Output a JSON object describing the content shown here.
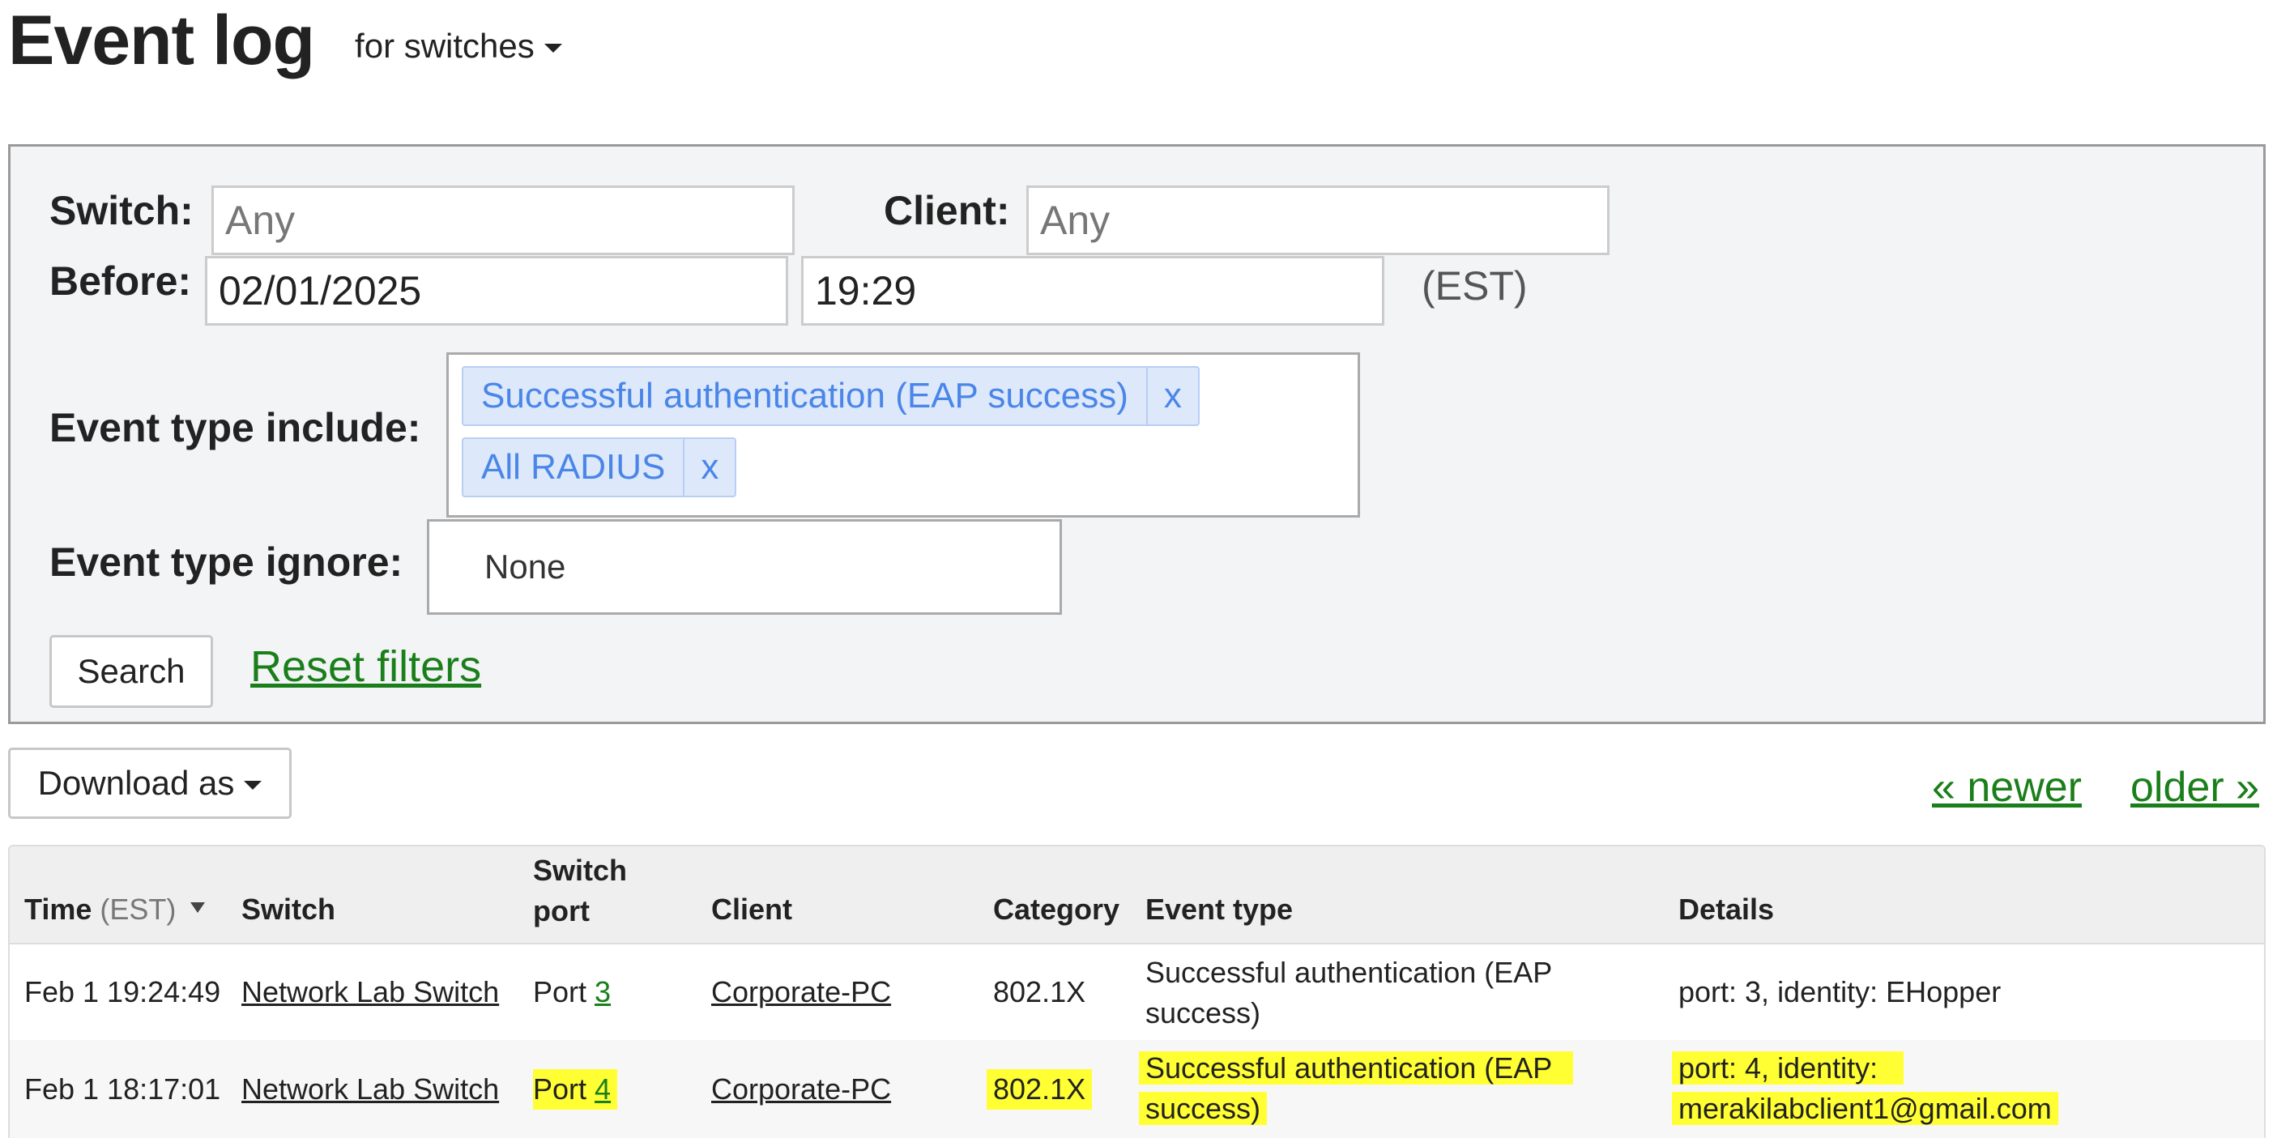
{
  "header": {
    "title": "Event log",
    "scope": "for switches"
  },
  "filters": {
    "switch_label": "Switch:",
    "switch_placeholder": "Any",
    "client_label": "Client:",
    "client_placeholder": "Any",
    "before_label": "Before:",
    "before_date": "02/01/2025",
    "before_time": "19:29",
    "timezone": "(EST)",
    "include_label": "Event type include:",
    "include_tags": [
      {
        "label": "Successful authentication (EAP success)",
        "remove": "x"
      },
      {
        "label": "All RADIUS",
        "remove": "x"
      }
    ],
    "ignore_label": "Event type ignore:",
    "ignore_value": "None",
    "search_label": "Search",
    "reset_label": "Reset filters"
  },
  "toolbar": {
    "download_label": "Download as",
    "newer_label": "« newer",
    "older_label": "older »"
  },
  "table": {
    "columns": {
      "time": "Time",
      "time_tz": "(EST)",
      "switch": "Switch",
      "switch_port_l1": "Switch",
      "switch_port_l2": "port",
      "client": "Client",
      "category": "Category",
      "event_type": "Event type",
      "details": "Details"
    },
    "rows": [
      {
        "time": "Feb 1 19:24:49",
        "switch": "Network Lab Switch",
        "port_prefix": "Port",
        "port_num": "3",
        "client": "Corporate-PC",
        "category": "802.1X",
        "event_type_l1": "Successful authentication (EAP",
        "event_type_l2": "success)",
        "details": "port: 3, identity: EHopper"
      },
      {
        "time": "Feb 1 18:17:01",
        "switch": "Network Lab Switch",
        "port_prefix": "Port",
        "port_num": "4",
        "client": "Corporate-PC",
        "category": "802.1X",
        "event_type_l1": "Successful authentication (EAP",
        "event_type_l2": "success)",
        "details_l1": "port: 4, identity:",
        "details_l2": "merakilabclient1@gmail.com"
      }
    ]
  },
  "colors": {
    "link": "#1a7f1a",
    "tag_bg": "#dde8fb",
    "tag_text": "#4a86e8",
    "highlight": "#ffff33"
  }
}
